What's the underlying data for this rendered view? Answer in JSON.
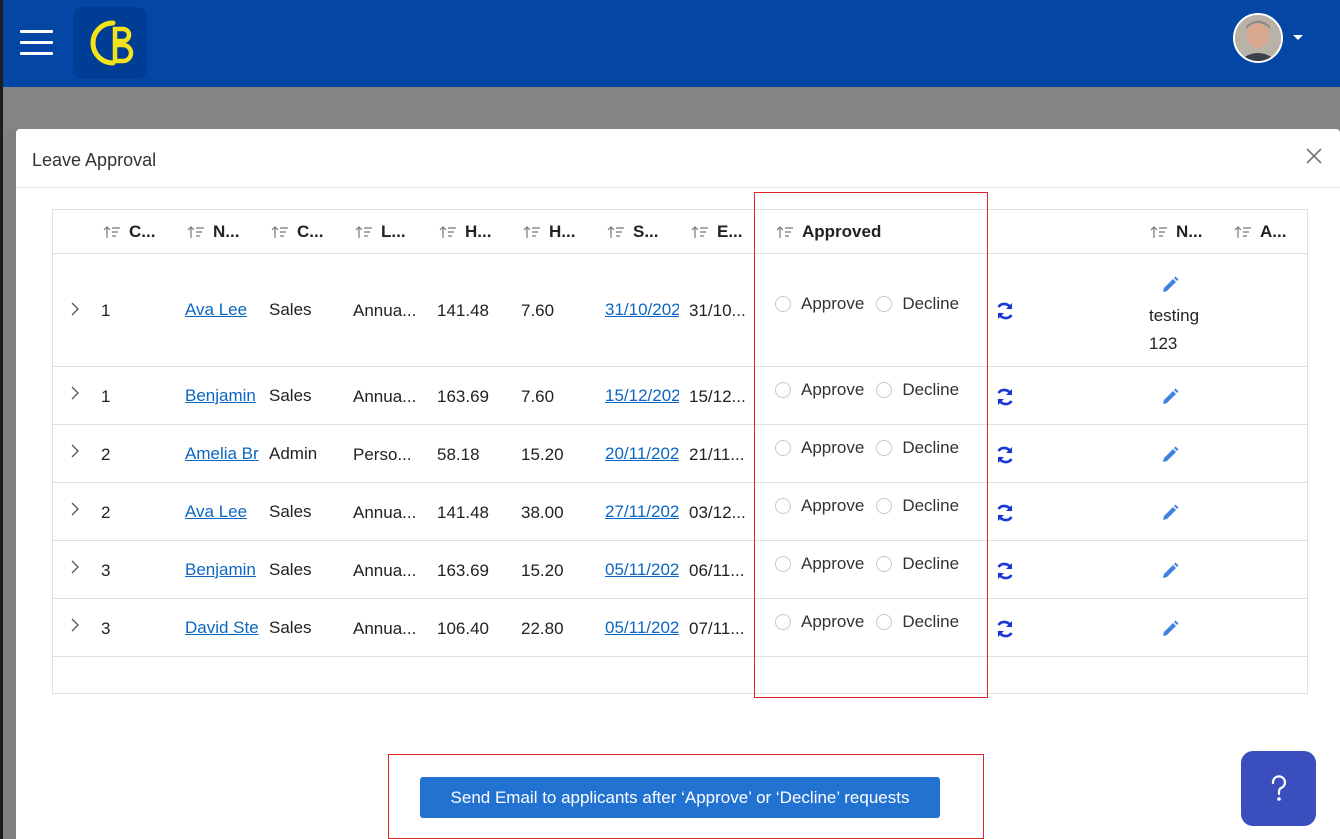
{
  "header": {
    "menu_icon": "hamburger-menu-icon",
    "logo_icon": "app-logo-icon",
    "avatar_icon": "user-avatar",
    "dropdown_icon": "caret-down-icon",
    "brand_color": "#0446a3",
    "logo_color": "#f4e21b"
  },
  "dialog": {
    "title": "Leave Approval",
    "close_icon": "close-icon"
  },
  "table": {
    "columns": [
      "C...",
      "N...",
      "C...",
      "L...",
      "H...",
      "H...",
      "S...",
      "E...",
      "Approved",
      "N...",
      "A..."
    ],
    "rows": [
      {
        "col1": "1",
        "name": "Ava Lee",
        "dept": "Sales",
        "leave": "Annua...",
        "h1": "141.48",
        "h2": "7.60",
        "start": "31/10/202",
        "end": "31/10...",
        "note": [
          "testing",
          "123"
        ]
      },
      {
        "col1": "1",
        "name": "Benjamin",
        "dept": "Sales",
        "leave": "Annua...",
        "h1": "163.69",
        "h2": "7.60",
        "start": "15/12/202",
        "end": "15/12...",
        "note": []
      },
      {
        "col1": "2",
        "name": "Amelia Br",
        "dept": "Admin",
        "leave": "Perso...",
        "h1": "58.18",
        "h2": "15.20",
        "start": "20/11/202",
        "end": "21/11...",
        "note": []
      },
      {
        "col1": "2",
        "name": "Ava Lee",
        "dept": "Sales",
        "leave": "Annua...",
        "h1": "141.48",
        "h2": "38.00",
        "start": "27/11/202",
        "end": "03/12...",
        "note": []
      },
      {
        "col1": "3",
        "name": "Benjamin",
        "dept": "Sales",
        "leave": "Annua...",
        "h1": "163.69",
        "h2": "15.20",
        "start": "05/11/202",
        "end": "06/11...",
        "note": []
      },
      {
        "col1": "3",
        "name": "David Ste",
        "dept": "Sales",
        "leave": "Annua...",
        "h1": "106.40",
        "h2": "22.80",
        "start": "05/11/202",
        "end": "07/11...",
        "note": []
      }
    ],
    "approve_label": "Approve",
    "decline_label": "Decline",
    "sort_icon": "sort-icon",
    "refresh_icon": "refresh-icon",
    "edit_icon": "pencil-icon",
    "expand_icon": "chevron-right-icon"
  },
  "footer": {
    "send_email_label": "Send Email to applicants after ‘Approve’ or ‘Decline’ requests",
    "help_icon": "help-icon"
  }
}
